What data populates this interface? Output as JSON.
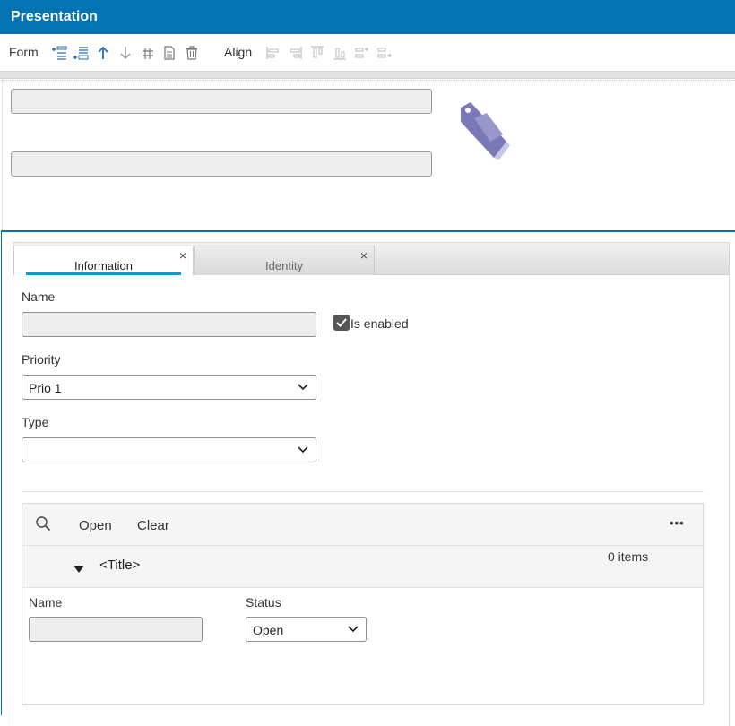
{
  "window": {
    "title": "Presentation"
  },
  "toolbar": {
    "form_label": "Form",
    "align_label": "Align",
    "form_icons": [
      "add-field-above-icon",
      "add-field-below-icon",
      "move-up-icon",
      "move-down-icon",
      "grid-icon",
      "document-icon",
      "delete-icon"
    ],
    "align_icons": [
      "align-left-icon",
      "align-right-icon",
      "align-top-icon",
      "align-bottom-icon",
      "distribute-horizontal-icon",
      "distribute-vertical-icon"
    ]
  },
  "header": {
    "field1_value": "",
    "field2_value": "",
    "icon": "price-tag-icon"
  },
  "tabs": [
    {
      "label": "Information",
      "active": true,
      "close": "×"
    },
    {
      "label": "Identity",
      "active": false,
      "close": "×"
    }
  ],
  "form": {
    "name_label": "Name",
    "name_value": "",
    "enabled_label": "Is enabled",
    "enabled_checked": true,
    "priority_label": "Priority",
    "priority_value": "Prio 1",
    "type_label": "Type",
    "type_value": ""
  },
  "grid": {
    "open_label": "Open",
    "clear_label": "Clear",
    "more_label": "•••",
    "group_title": "<Title>",
    "items_count": "0 items",
    "columns": [
      "Name",
      "Status"
    ],
    "row": {
      "name_value": "",
      "status_value": "Open"
    }
  },
  "colors": {
    "accent": "#0374b1",
    "tab_underline": "#1496d6",
    "tag": "#7b78b8"
  }
}
